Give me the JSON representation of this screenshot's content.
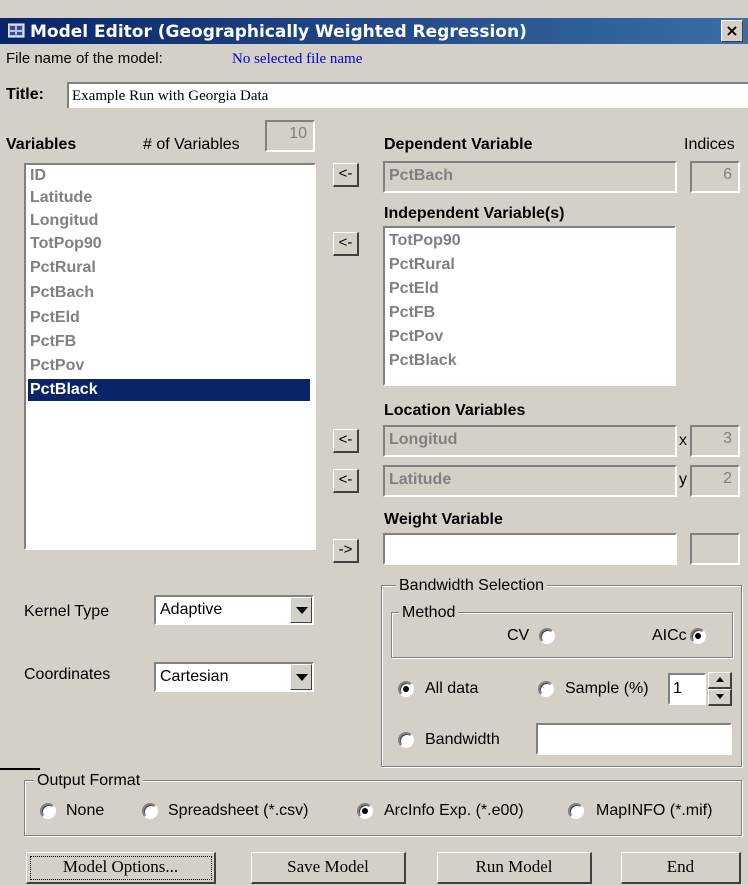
{
  "window": {
    "title": "Model Editor (Geographically Weighted Regression)",
    "close_glyph": "×"
  },
  "file": {
    "label": "File name of the model:",
    "value": "No selected file name"
  },
  "title_field": {
    "label": "Title:",
    "value": "Example Run with Georgia Data"
  },
  "variables": {
    "label": "Variables",
    "count_label": "# of Variables",
    "count": "10",
    "items": [
      "ID",
      "Latitude",
      "Longitud",
      "TotPop90",
      "PctRural",
      "PctBach",
      "PctEld",
      "PctFB",
      "PctPov",
      "PctBlack"
    ],
    "selected": "PctBlack"
  },
  "dependent": {
    "label": "Dependent Variable",
    "indices_label": "Indices",
    "value": "PctBach",
    "index": "6"
  },
  "independent": {
    "label": "Independent Variable(s)",
    "items": [
      "TotPop90",
      "PctRural",
      "PctEld",
      "PctFB",
      "PctPov",
      "PctBlack"
    ]
  },
  "location": {
    "label": "Location Variables",
    "x": {
      "value": "Longitud",
      "axis": "x",
      "index": "3"
    },
    "y": {
      "value": "Latitude",
      "axis": "y",
      "index": "2"
    }
  },
  "weight": {
    "label": "Weight Variable",
    "value": "",
    "index": ""
  },
  "arrows": {
    "left": "<-",
    "right": "->"
  },
  "kernel": {
    "label": "Kernel Type",
    "value": "Adaptive"
  },
  "coordinates": {
    "label": "Coordinates",
    "value": "Cartesian"
  },
  "bandwidth": {
    "label": "Bandwidth Selection",
    "method_label": "Method",
    "cv_label": "CV",
    "aicc_label": "AICc",
    "method_selected": "AICc",
    "all_data_label": "All data",
    "sample_label": "Sample (%)",
    "sample_value": "1",
    "bandwidth_label": "Bandwidth",
    "bandwidth_value": "",
    "range_selected": "All data"
  },
  "output": {
    "label": "Output Format",
    "options": [
      "None",
      "Spreadsheet (*.csv)",
      "ArcInfo Exp. (*.e00)",
      "MapINFO (*.mif)"
    ],
    "selected": "ArcInfo Exp. (*.e00)"
  },
  "buttons": {
    "model_options": "Model Options...",
    "save_model": "Save Model",
    "run_model": "Run Model",
    "end": "End"
  },
  "colors": {
    "titlebar_start": "#0a246a",
    "titlebar_end": "#3a6ea5",
    "selection": "#0a246a",
    "face": "#d4d0c8",
    "file_link": "#0000cc"
  }
}
